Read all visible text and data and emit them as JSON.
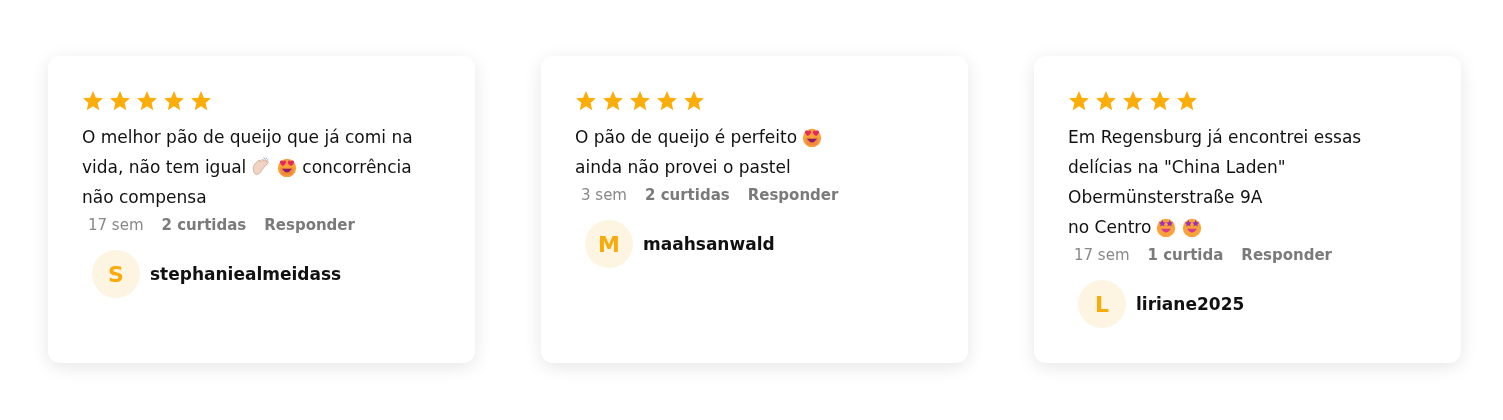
{
  "reviews": [
    {
      "stars": 5,
      "lines": [
        [
          {
            "kind": "text",
            "text": "O melhor pão de queijo que já comi na"
          }
        ],
        [
          {
            "kind": "text",
            "text": "vida, não tem igual"
          },
          {
            "kind": "clap"
          },
          {
            "kind": "heart-eyes"
          },
          {
            "kind": "text",
            "text": "concorrência"
          }
        ],
        [
          {
            "kind": "text",
            "text": "não compensa"
          }
        ]
      ],
      "time": "17 sem",
      "likes": "2 curtidas",
      "reply": "Responder",
      "initial": "S",
      "user": "stephaniealmeidass"
    },
    {
      "stars": 5,
      "lines": [
        [
          {
            "kind": "text",
            "text": "O pão de queijo é perfeito"
          },
          {
            "kind": "heart-eyes"
          }
        ],
        [
          {
            "kind": "text",
            "text": "ainda não provei o pastel"
          }
        ]
      ],
      "time": "3 sem",
      "likes": "2 curtidas",
      "reply": "Responder",
      "initial": "M",
      "user": "maahsanwald"
    },
    {
      "stars": 5,
      "lines": [
        [
          {
            "kind": "text",
            "text": "Em Regensburg já encontrei essas"
          }
        ],
        [
          {
            "kind": "text",
            "text": "delícias na \"China Laden\""
          }
        ],
        [
          {
            "kind": "text",
            "text": "Obermünsterstraße 9A"
          }
        ],
        [
          {
            "kind": "text",
            "text": "no Centro"
          },
          {
            "kind": "star-eyes"
          },
          {
            "kind": "star-eyes"
          }
        ]
      ],
      "time": "17 sem",
      "likes": "1 curtida",
      "reply": "Responder",
      "initial": "L",
      "user": "liriane2025"
    }
  ]
}
